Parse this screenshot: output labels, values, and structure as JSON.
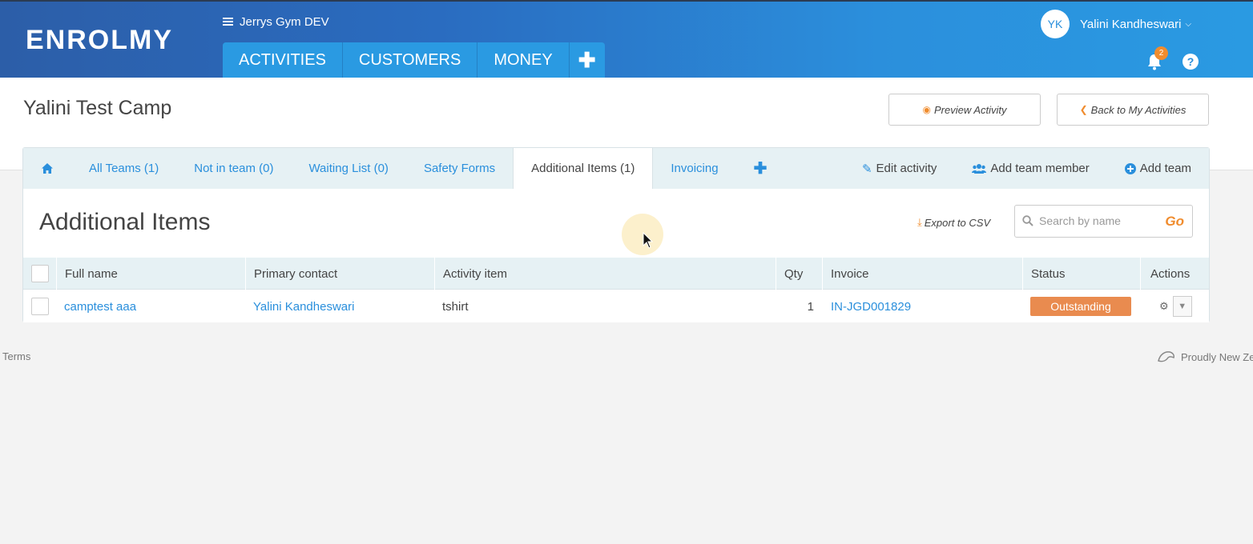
{
  "header": {
    "logo": "ENROLMY",
    "workspace": "Jerrys Gym DEV",
    "nav": [
      "ACTIVITIES",
      "CUSTOMERS",
      "MONEY"
    ],
    "nav_plus": "✚",
    "user_initials": "YK",
    "user_name": "Yalini Kandheswari",
    "notification_count": "2",
    "help_label": "?"
  },
  "page": {
    "title": "Yalini Test Camp",
    "preview_button": "Preview Activity",
    "back_button": "Back to My Activities"
  },
  "tabs": {
    "items": [
      "All Teams (1)",
      "Not in team (0)",
      "Waiting List (0)",
      "Safety Forms",
      "Additional Items (1)",
      "Invoicing"
    ],
    "active_index": 4,
    "plus": "✚",
    "edit_activity": "Edit activity",
    "add_team_member": "Add team member",
    "add_team": "Add team"
  },
  "section": {
    "title": "Additional Items",
    "export": "Export to CSV",
    "search_placeholder": "Search by name",
    "search_go": "Go"
  },
  "table": {
    "columns": [
      "Full name",
      "Primary contact",
      "Activity item",
      "Qty",
      "Invoice",
      "Status",
      "Actions"
    ],
    "rows": [
      {
        "full_name": "camptest aaa",
        "primary_contact": "Yalini Kandheswari",
        "activity_item": "tshirt",
        "qty": "1",
        "invoice": "IN-JGD001829",
        "status": "Outstanding"
      }
    ]
  },
  "footer": {
    "terms": "Terms",
    "made_in": "Proudly New Ze"
  },
  "colors": {
    "accent": "#2a8fdc",
    "orange": "#f08c2e",
    "status_outstanding": "#e98b4f"
  }
}
